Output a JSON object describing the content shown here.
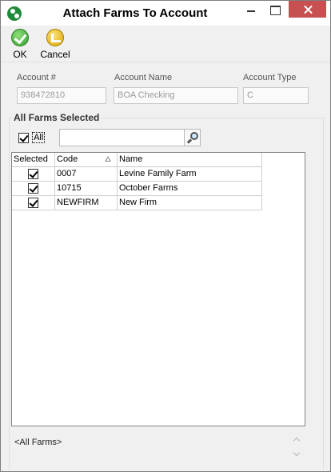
{
  "window": {
    "title": "Attach Farms To Account"
  },
  "toolbar": {
    "ok_label": "OK",
    "cancel_label": "Cancel"
  },
  "account": {
    "number_label": "Account #",
    "number_value": "938472810",
    "name_label": "Account Name",
    "name_value": "BOA Checking",
    "type_label": "Account Type",
    "type_value": "C"
  },
  "farms": {
    "section_title": "All Farms Selected",
    "all_label": "All",
    "all_checked": true,
    "search_value": "",
    "columns": [
      "Selected",
      "Code",
      "Name"
    ],
    "sort_column": "Code",
    "rows": [
      {
        "selected": true,
        "code": "0007",
        "name": "Levine Family Farm"
      },
      {
        "selected": true,
        "code": "10715",
        "name": "October Farms"
      },
      {
        "selected": true,
        "code": "NEWFIRM",
        "name": "New Firm"
      }
    ]
  },
  "filter": {
    "text": "<All Farms>"
  }
}
